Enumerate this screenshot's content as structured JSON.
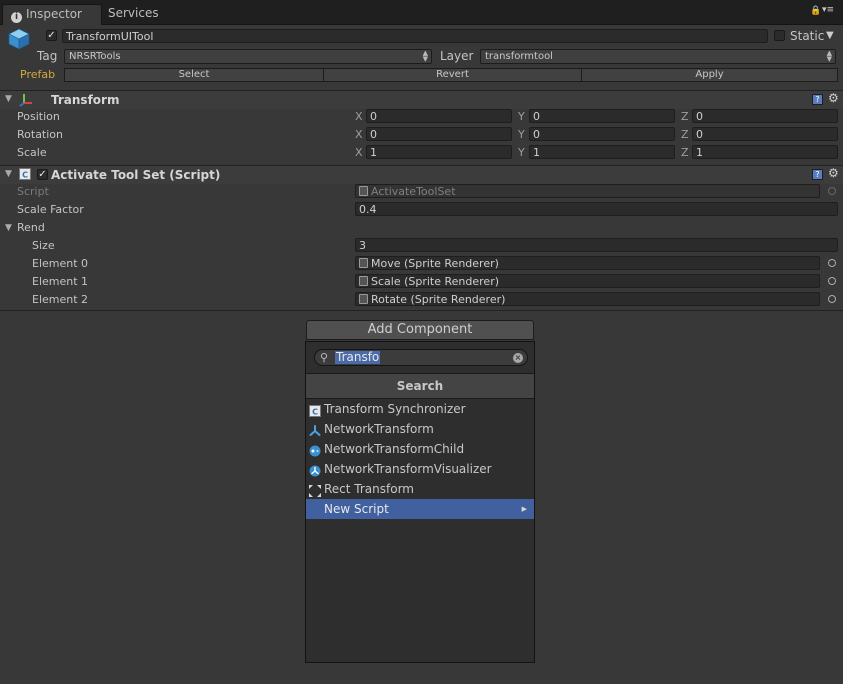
{
  "tabs": [
    {
      "label": "Inspector",
      "active": true
    },
    {
      "label": "Services",
      "active": false
    }
  ],
  "object": {
    "name": "TransformUITool",
    "active": true,
    "static_label": "Static",
    "tag_label": "Tag",
    "tag_value": "NRSRTools",
    "layer_label": "Layer",
    "layer_value": "transformtool",
    "prefab_label": "Prefab",
    "prefab_buttons": [
      "Select",
      "Revert",
      "Apply"
    ]
  },
  "transform": {
    "title": "Transform",
    "rows": [
      {
        "label": "Position",
        "x": "0",
        "y": "0",
        "z": "0"
      },
      {
        "label": "Rotation",
        "x": "0",
        "y": "0",
        "z": "0"
      },
      {
        "label": "Scale",
        "x": "1",
        "y": "1",
        "z": "1"
      }
    ],
    "axes": [
      "X",
      "Y",
      "Z"
    ]
  },
  "script_component": {
    "title": "Activate Tool Set (Script)",
    "script_label": "Script",
    "script_value": "ActivateToolSet",
    "scale_factor_label": "Scale Factor",
    "scale_factor_value": "0.4",
    "rend_label": "Rend",
    "size_label": "Size",
    "size_value": "3",
    "elements": [
      {
        "label": "Element 0",
        "value": "Move (Sprite Renderer)"
      },
      {
        "label": "Element 1",
        "value": "Scale (Sprite Renderer)"
      },
      {
        "label": "Element 2",
        "value": "Rotate (Sprite Renderer)"
      }
    ]
  },
  "add_component": {
    "button_label": "Add Component",
    "search_text": "Transfo",
    "header": "Search",
    "items": [
      {
        "label": "Transform Synchronizer",
        "icon": "script-icon"
      },
      {
        "label": "NetworkTransform",
        "icon": "network-transform-icon"
      },
      {
        "label": "NetworkTransformChild",
        "icon": "network-transform-child-icon"
      },
      {
        "label": "NetworkTransformVisualizer",
        "icon": "network-visualizer-icon"
      },
      {
        "label": "Rect Transform",
        "icon": "rect-transform-icon"
      },
      {
        "label": "New Script",
        "icon": "",
        "highlighted": true,
        "submenu": true
      }
    ]
  },
  "colors": {
    "background": "#383838",
    "highlight": "#4060a0",
    "prefab": "#d6a93c"
  }
}
